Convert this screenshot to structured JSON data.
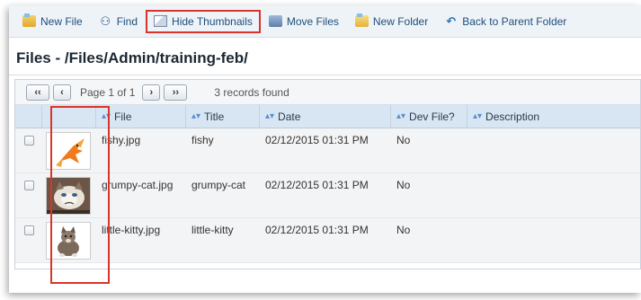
{
  "toolbar": {
    "new_file": "New File",
    "find": "Find",
    "hide_thumbnails": "Hide Thumbnails",
    "move_files": "Move Files",
    "new_folder": "New Folder",
    "back_to_parent": "Back to Parent Folder"
  },
  "page": {
    "title": "Files - /Files/Admin/training-feb/"
  },
  "pager": {
    "first": "‹‹",
    "prev": "‹",
    "page_text": "Page 1 of 1",
    "next": "›",
    "last": "››",
    "records": "3 records found"
  },
  "columns": {
    "file": "File",
    "title": "Title",
    "date": "Date",
    "dev": "Dev File?",
    "description": "Description"
  },
  "rows": [
    {
      "file": "fishy.jpg",
      "title": "fishy",
      "date": "02/12/2015 01:31 PM",
      "dev": "No",
      "description": "",
      "thumb_icon": "goldfish-thumbnail"
    },
    {
      "file": "grumpy-cat.jpg",
      "title": "grumpy-cat",
      "date": "02/12/2015 01:31 PM",
      "dev": "No",
      "description": "",
      "thumb_icon": "cat-thumbnail"
    },
    {
      "file": "little-kitty.jpg",
      "title": "little-kitty",
      "date": "02/12/2015 01:31 PM",
      "dev": "No",
      "description": "",
      "thumb_icon": "kitten-thumbnail"
    }
  ],
  "colors": {
    "highlight": "#d9342b",
    "toolbar_text": "#1f4e7a",
    "header_bg": "#d8e6f4"
  }
}
